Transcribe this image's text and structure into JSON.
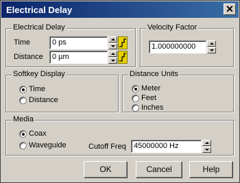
{
  "window": {
    "title": "Electrical Delay",
    "close_label": "✕"
  },
  "electrical_delay": {
    "group_label": "Electrical Delay",
    "time_label": "Time",
    "time_value": "0 ps",
    "distance_label": "Distance",
    "distance_value": "0 µm"
  },
  "velocity_factor": {
    "group_label": "Velocity Factor",
    "value": "1.000000000"
  },
  "softkey_display": {
    "group_label": "Softkey Display",
    "options": [
      {
        "label": "Time",
        "selected": true
      },
      {
        "label": "Distance",
        "selected": false
      }
    ]
  },
  "distance_units": {
    "group_label": "Distance Units",
    "options": [
      {
        "label": "Meter",
        "selected": true
      },
      {
        "label": "Feet",
        "selected": false
      },
      {
        "label": "Inches",
        "selected": false
      }
    ]
  },
  "media": {
    "group_label": "Media",
    "options": [
      {
        "label": "Coax",
        "selected": true
      },
      {
        "label": "Waveguide",
        "selected": false
      }
    ],
    "cutoff_label": "Cutoff Freq",
    "cutoff_value": "45000000 Hz"
  },
  "buttons": {
    "ok": "OK",
    "cancel": "Cancel",
    "help": "Help"
  }
}
